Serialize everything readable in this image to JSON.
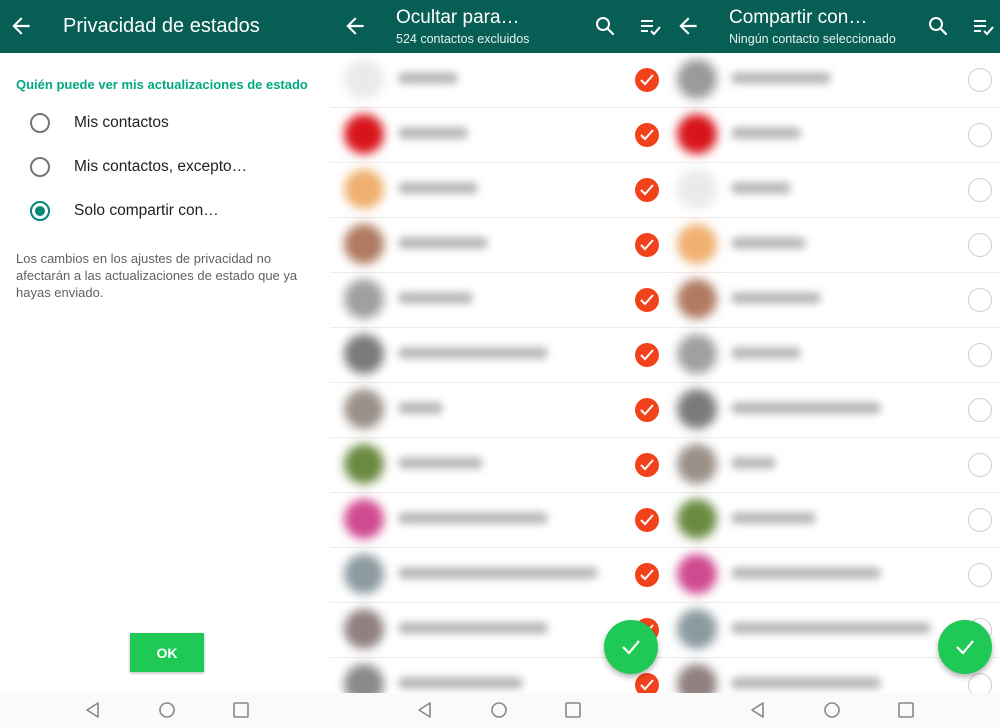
{
  "colors": {
    "appbar": "#075e54",
    "accent": "#00a884",
    "radio_selected": "#00897b",
    "checkbox_checked": "#f2421c",
    "ok_button": "#1ec955",
    "fab": "#1ec955"
  },
  "screen1": {
    "title": "Privacidad de estados",
    "section_header": "Quién puede ver mis actualizaciones de estado",
    "options": [
      {
        "label": "Mis contactos",
        "selected": false
      },
      {
        "label": "Mis contactos, excepto…",
        "selected": false
      },
      {
        "label": "Solo compartir con…",
        "selected": true
      }
    ],
    "note": "Los cambios en los ajustes de privacidad no afectarán a las actualizaciones de estado que ya hayas enviado.",
    "ok_label": "OK"
  },
  "screen2": {
    "title": "Ocultar para…",
    "subtitle": "524 contactos excluidos",
    "icons": [
      "back-arrow-icon",
      "search-icon",
      "select-all-icon",
      "check-icon"
    ],
    "rows": [
      {
        "checked": true
      },
      {
        "checked": true
      },
      {
        "checked": true
      },
      {
        "checked": true
      },
      {
        "checked": true
      },
      {
        "checked": true
      },
      {
        "checked": true
      },
      {
        "checked": true
      },
      {
        "checked": true
      },
      {
        "checked": true
      },
      {
        "checked": true
      },
      {
        "checked": true
      }
    ]
  },
  "screen3": {
    "title": "Compartir con…",
    "subtitle": "Ningún contacto seleccionado",
    "icons": [
      "back-arrow-icon",
      "search-icon",
      "select-all-icon",
      "check-icon"
    ],
    "rows": [
      {
        "checked": false
      },
      {
        "checked": false
      },
      {
        "checked": false
      },
      {
        "checked": false
      },
      {
        "checked": false
      },
      {
        "checked": false
      },
      {
        "checked": false
      },
      {
        "checked": false
      },
      {
        "checked": false
      },
      {
        "checked": false
      },
      {
        "checked": false
      },
      {
        "checked": false
      }
    ]
  },
  "navigation_bar": {
    "icons": [
      "nav-back-icon",
      "nav-home-icon",
      "nav-recents-icon"
    ]
  }
}
